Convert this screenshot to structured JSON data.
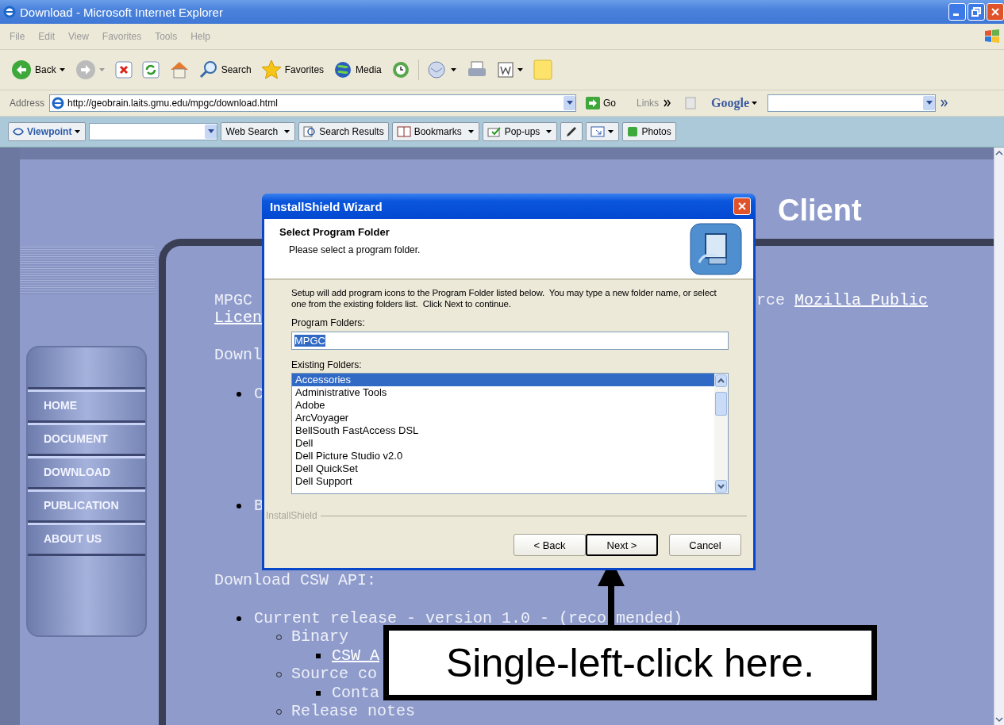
{
  "window": {
    "title": "Download - Microsoft Internet Explorer"
  },
  "menu": [
    "File",
    "Edit",
    "View",
    "Favorites",
    "Tools",
    "Help"
  ],
  "toolbar": {
    "back": "Back",
    "search": "Search",
    "favorites": "Favorites",
    "media": "Media"
  },
  "address_bar": {
    "label": "Address",
    "url": "http://geobrain.laits.gmu.edu/mpgc/download.html",
    "go": "Go",
    "links": "Links",
    "google": "Google"
  },
  "viewpoint_bar": {
    "viewpoint": "Viewpoint",
    "buttons": [
      {
        "label": "Web Search",
        "dropdown": true
      },
      {
        "label": "Search Results",
        "dropdown": false
      },
      {
        "label": "Bookmarks",
        "dropdown": true
      },
      {
        "label": "Pop-ups",
        "dropdown": true
      },
      {
        "label": "Photos",
        "dropdown": false
      }
    ]
  },
  "page": {
    "heading": "Client",
    "intro_left": "MPGC",
    "intro_right": "rce",
    "license_link": "Mozilla Public",
    "license_link_cont": "Licen",
    "download_fragment": "Downl",
    "bullets": [
      "C",
      "B"
    ],
    "csw_heading": "Download CSW API:",
    "csw_list": [
      {
        "text": "Current release - version 1.0 - (reco",
        "text_after": "mended)",
        "children": [
          {
            "text": "Binary",
            "children": [
              {
                "text": "CSW A",
                "link": true
              }
            ]
          },
          {
            "text": "Source co",
            "children": [
              {
                "text": "Conta",
                "link": false
              }
            ]
          },
          {
            "text": "Release notes"
          }
        ]
      }
    ]
  },
  "nav": [
    "HOME",
    "DOCUMENT",
    "DOWNLOAD",
    "PUBLICATION",
    "ABOUT US"
  ],
  "dialog": {
    "title": "InstallShield Wizard",
    "heading": "Select Program Folder",
    "subheading": "Please select a program folder.",
    "description": "Setup will add program icons to the Program Folder listed below.  You may type a new folder name, or select one from the existing folders list.  Click Next to continue.",
    "folder_label": "Program Folders:",
    "folder_value": "MPGC",
    "existing_label": "Existing Folders:",
    "folders": [
      {
        "name": "Accessories",
        "selected": true
      },
      {
        "name": "Administrative Tools",
        "selected": false
      },
      {
        "name": "Adobe",
        "selected": false
      },
      {
        "name": "ArcVoyager",
        "selected": false
      },
      {
        "name": "BellSouth FastAccess DSL",
        "selected": false
      },
      {
        "name": "Dell",
        "selected": false
      },
      {
        "name": "Dell Picture Studio v2.0",
        "selected": false
      },
      {
        "name": "Dell QuickSet",
        "selected": false
      },
      {
        "name": "Dell Support",
        "selected": false
      }
    ],
    "brand": "InstallShield",
    "buttons": [
      {
        "label": "< Back",
        "focused": false
      },
      {
        "label": "Next >",
        "focused": true
      },
      {
        "label": "Cancel",
        "focused": false
      }
    ]
  },
  "callout": {
    "text": "Single-left-click here."
  }
}
